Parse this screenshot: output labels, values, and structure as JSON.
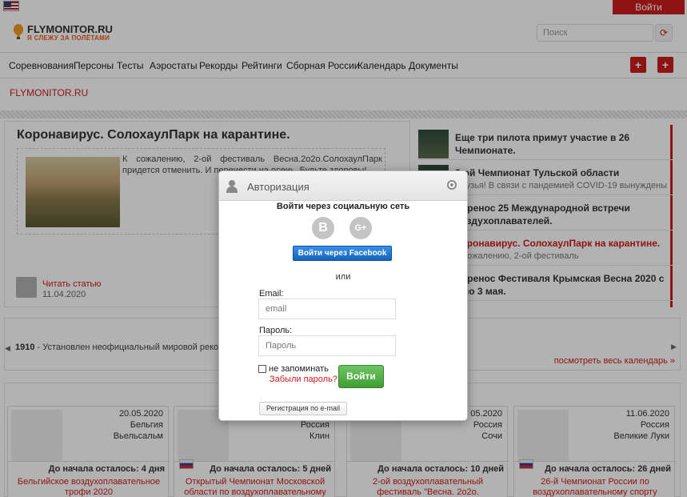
{
  "topbar": {
    "login_label": "Войти"
  },
  "header": {
    "logo_title": "FLYMONITOR.RU",
    "logo_subtitle": "Я СЛЕЖУ ЗА ПОЛЁТАМИ",
    "search_placeholder": "Поиск"
  },
  "nav": {
    "items": [
      "Соревнования",
      "Персоны",
      "Тесты",
      "Аэростаты",
      "Рекорды",
      "Рейтинги",
      "Сборная России",
      "Календарь",
      "Документы"
    ],
    "plus1": "+",
    "plus2": "+"
  },
  "breadcrumb": "FLYMONITOR.RU",
  "article": {
    "title": "Коронавирус. СолохаулПарк на карантине.",
    "text": "К сожалению, 2-ой фестиваль Весна.2о2о.СолохаулПарк придется отменить. И перенести на осень. Будьте здоровы!",
    "read_label": "Читать статью",
    "date": "11.04.2020"
  },
  "news": [
    {
      "title": "Еще три пилота примут участие в 26 Чемпионате.",
      "sub": ""
    },
    {
      "title": "8-ой Чемпионат Тульской области",
      "sub": "Друзья! В связи с пандемией COVID-19 вынуждены"
    },
    {
      "title": "Перенос 25 Международной встречи воздухоплавателей.",
      "sub": ""
    },
    {
      "title": "Коронавирус. СолохаулПарк на карантине.",
      "sub": "К сожалению, 2-ой фестиваль"
    },
    {
      "title": "Перенос Фестиваля Крымская Весна 2020 с 1 по 3 мая.",
      "sub": ""
    }
  ],
  "calendar": {
    "year": "1910",
    "text": " - Установлен неофициальный мировой рекорд ... минут.",
    "link": "посмотреть весь календарь »"
  },
  "events": [
    {
      "date": "20.05.2020",
      "country": "Бельгия",
      "city": "Вьельсальм",
      "left": "До начала осталось: 4 дня",
      "name": "Бельгийское воздухоплавательное трофи 2020"
    },
    {
      "date": "",
      "country": "Россия",
      "city": "Клин",
      "left": "До начала осталось: 5 дней",
      "name": "Открытый Чемпионат Московской области по воздухоплавательному"
    },
    {
      "date": "05.2020",
      "country": "Россия",
      "city": "Сочи",
      "left": "До начала осталось: 10 дней",
      "name": "2-ой воздухоплавательный фестиваль \"Весна. 2о2о."
    },
    {
      "date": "11.06.2020",
      "country": "Россия",
      "city": "Великие Луки",
      "left": "До начала осталось: 26 дней",
      "name": "26-й Чемпионат России по воздухоплавательному спорту"
    }
  ],
  "modal": {
    "title": "Авторизация",
    "social_title": "Войти через социальную сеть",
    "vk": "B",
    "gplus": "G+",
    "facebook_label": "Войти через Facebook",
    "or_label": "или",
    "email_label": "Email:",
    "email_placeholder": "email",
    "password_label": "Пароль:",
    "password_placeholder": "Пароль",
    "remember_label": "не запоминать",
    "forgot_label": "Забыли пароль?",
    "submit_label": "Войти",
    "register_label": "Регистрация по e-mail"
  },
  "colors": {
    "accent": "#cc1d1d",
    "submit": "#4fae43",
    "facebook": "#1f6fd0"
  }
}
